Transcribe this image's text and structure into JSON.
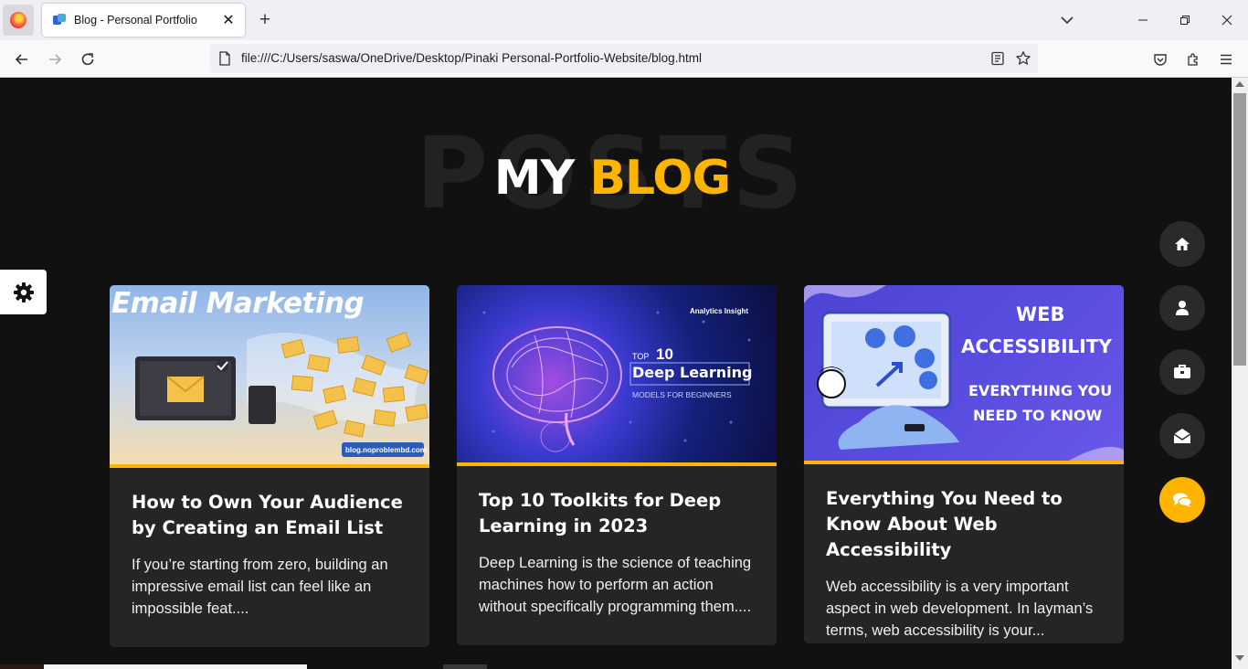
{
  "browser": {
    "tab_title": "Blog - Personal Portfolio",
    "tab_close": "✕",
    "new_tab": "+",
    "url": "file:///C:/Users/saswa/OneDrive/Desktop/Pinaki Personal-Portfolio-Website/blog.html",
    "window_controls": [
      "minimize",
      "restore",
      "close"
    ]
  },
  "page": {
    "background_word": "POSTS",
    "heading_white": "MY",
    "heading_yellow": "BLOG",
    "accent_color": "#ffb400"
  },
  "cards": [
    {
      "image_caption": "Email Marketing",
      "image_footer": "blog.noproblembd.com",
      "title": "How to Own Your Audience by Creating an Email List",
      "excerpt": "If you’re starting from zero, building an impressive email list can feel like an impossible feat...."
    },
    {
      "image_brand": "Analytics Insight",
      "image_top": "TOP",
      "image_number": "10",
      "image_headline": "Deep Learning",
      "image_subline": "MODELS FOR BEGINNERS",
      "title": "Top 10 Toolkits for Deep Learning in 2023",
      "excerpt": "Deep Learning is the science of teaching machines how to perform an action without specifically programming them...."
    },
    {
      "image_headline_1": "WEB",
      "image_headline_2": "ACCESSIBILITY",
      "image_sub_1": "EVERYTHING YOU",
      "image_sub_2": "NEED TO KNOW",
      "title": "Everything You Need to Know About Web Accessibility",
      "excerpt": "Web accessibility is a very important aspect in web development. In layman’s terms, web accessibility is your..."
    }
  ],
  "side_nav": [
    "home-icon",
    "user-icon",
    "briefcase-icon",
    "envelope-open-icon",
    "comments-icon"
  ],
  "settings_icon": "gear-icon"
}
